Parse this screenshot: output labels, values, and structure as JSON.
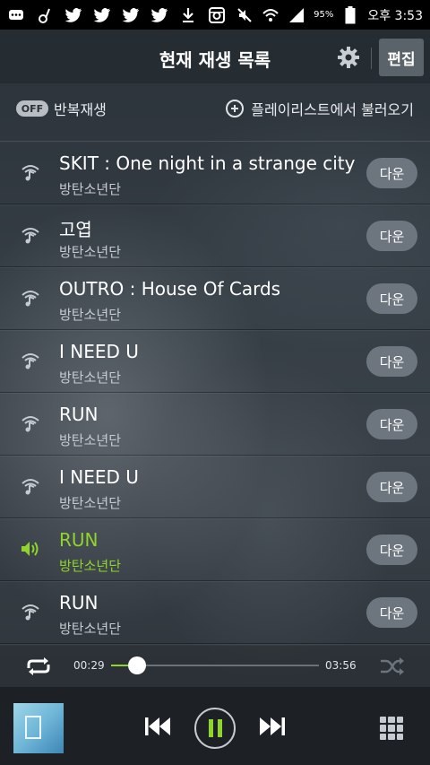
{
  "status_bar": {
    "battery_pct": "95%",
    "time": "오후 3:53"
  },
  "header": {
    "title": "현재 재생 목록",
    "edit_label": "편집"
  },
  "options": {
    "repeat_toggle": "OFF",
    "repeat_label": "반복재생",
    "load_playlist_label": "플레이리스트에서 불러오기"
  },
  "playlist": [
    {
      "title": "SKIT : One night in a strange city",
      "artist": "방탄소년단",
      "action": "다운",
      "playing": false
    },
    {
      "title": "고엽",
      "artist": "방탄소년단",
      "action": "다운",
      "playing": false
    },
    {
      "title": "OUTRO : House Of Cards",
      "artist": "방탄소년단",
      "action": "다운",
      "playing": false
    },
    {
      "title": "I NEED U",
      "artist": "방탄소년단",
      "action": "다운",
      "playing": false
    },
    {
      "title": "RUN",
      "artist": "방탄소년단",
      "action": "다운",
      "playing": false
    },
    {
      "title": "I NEED U",
      "artist": "방탄소년단",
      "action": "다운",
      "playing": false
    },
    {
      "title": "RUN",
      "artist": "방탄소년단",
      "action": "다운",
      "playing": true
    },
    {
      "title": "RUN",
      "artist": "방탄소년단",
      "action": "다운",
      "playing": false
    }
  ],
  "playback": {
    "current_time": "00:29",
    "total_time": "03:56",
    "progress_fraction": 0.123
  },
  "colors": {
    "accent": "#8fd52a"
  }
}
